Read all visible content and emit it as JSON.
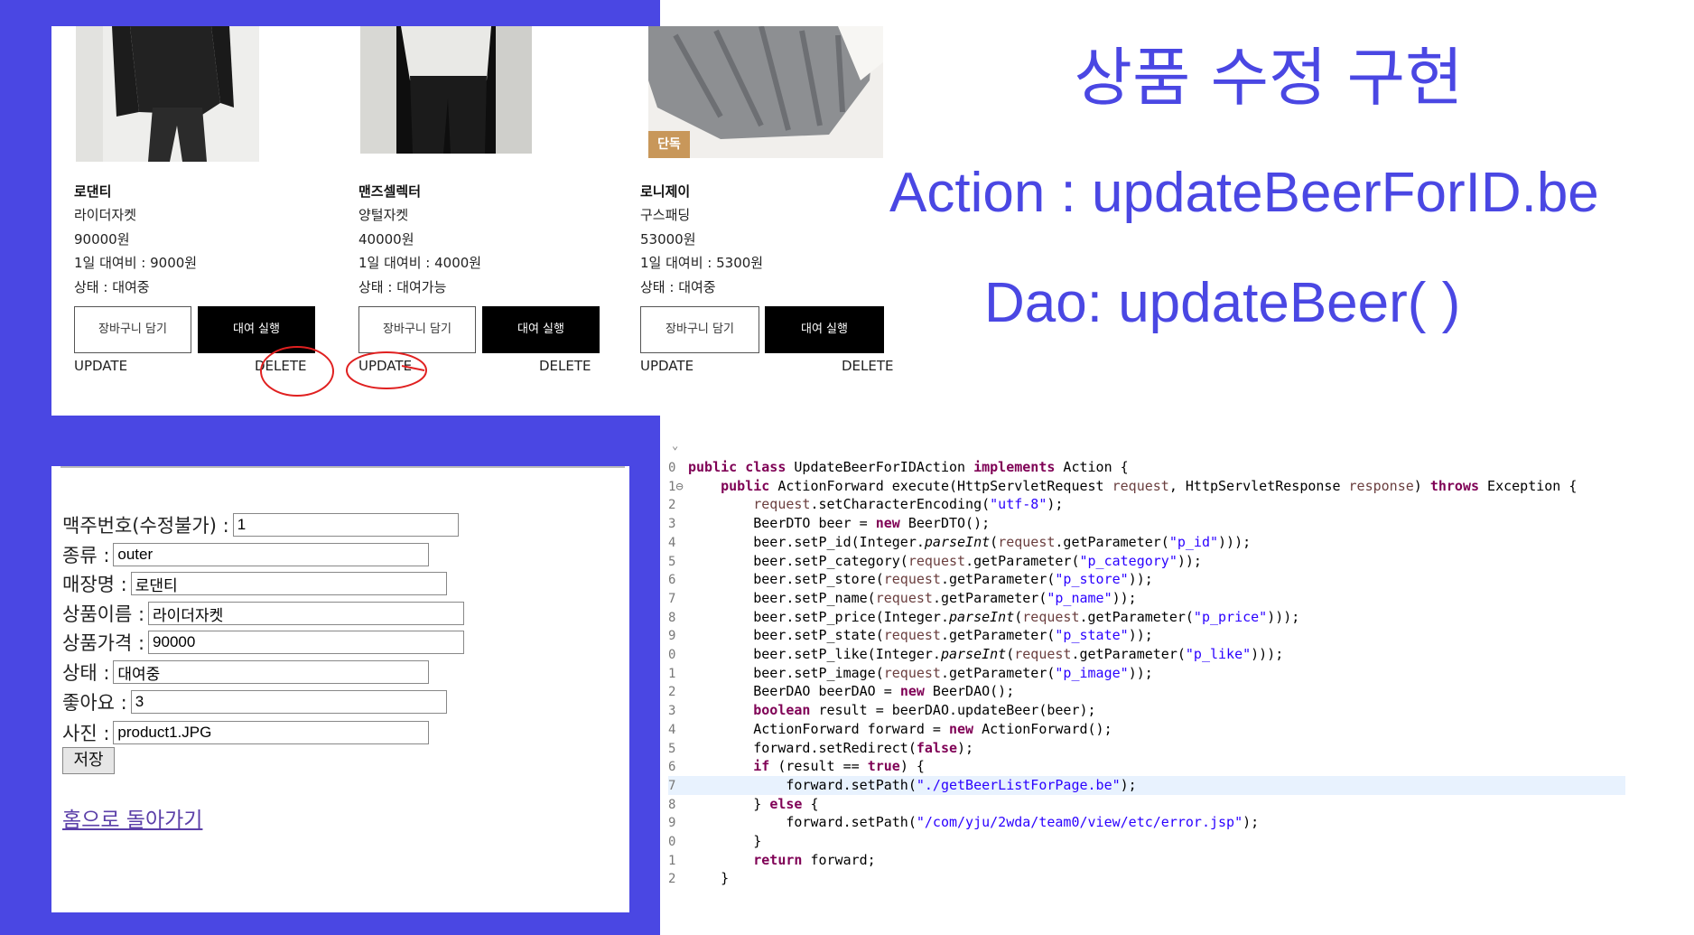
{
  "slide": {
    "title": "상품 수정 구현",
    "action_line": "Action : updateBeerForID.be",
    "dao_line": "Dao: updateBeer( )"
  },
  "products": [
    {
      "brand": "로댄티",
      "name": "라이더자켓",
      "price": "90000원",
      "daily_fee": "1일 대여비 : 9000원",
      "status": "상태 : 대여중",
      "cart_label": "장바구니 담기",
      "rent_label": "대여 실행",
      "update_label": "UPDATE",
      "delete_label": "DELETE"
    },
    {
      "brand": "맨즈셀렉터",
      "name": "양털자켓",
      "price": "40000원",
      "daily_fee": "1일 대여비 : 4000원",
      "status": "상태 : 대여가능",
      "cart_label": "장바구니 담기",
      "rent_label": "대여 실행",
      "update_label": "UPDATE",
      "delete_label": "DELETE"
    },
    {
      "brand": "로니제이",
      "name": "구스패딩",
      "price": "53000원",
      "daily_fee": "1일 대여비 : 5300원",
      "status": "상태 : 대여중",
      "cart_label": "장바구니 담기",
      "rent_label": "대여 실행",
      "update_label": "UPDATE",
      "delete_label": "DELETE",
      "badge": "단독"
    }
  ],
  "form": {
    "fields": [
      {
        "label": "맥주번호(수정불가) :",
        "value": "1"
      },
      {
        "label": "종류 :",
        "value": "outer"
      },
      {
        "label": "매장명 :",
        "value": "로댄티"
      },
      {
        "label": "상품이름 :",
        "value": "라이더자켓"
      },
      {
        "label": "상품가격 :",
        "value": "90000"
      },
      {
        "label": "상태 :",
        "value": "대여중"
      },
      {
        "label": "좋아요 :",
        "value": "3"
      },
      {
        "label": "사진 :",
        "value": "product1.JPG"
      }
    ],
    "save_label": "저장",
    "home_link": "홈으로 돌아가기"
  },
  "code": {
    "gutter": [
      "0",
      "1⊖",
      "2",
      "3",
      "4",
      "5",
      "6",
      "7",
      "8",
      "9",
      "0",
      "1",
      "2",
      "3",
      "4",
      "5",
      "6",
      "7",
      "8",
      "9",
      "0",
      "1",
      "2"
    ],
    "highlighted_line": 17,
    "lines": [
      "public class UpdateBeerForIDAction implements Action {",
      "    public ActionForward execute(HttpServletRequest request, HttpServletResponse response) throws Exception {",
      "        request.setCharacterEncoding(\"utf-8\");",
      "        BeerDTO beer = new BeerDTO();",
      "        beer.setP_id(Integer.parseInt(request.getParameter(\"p_id\")));",
      "        beer.setP_category(request.getParameter(\"p_category\"));",
      "        beer.setP_store(request.getParameter(\"p_store\"));",
      "        beer.setP_name(request.getParameter(\"p_name\"));",
      "        beer.setP_price(Integer.parseInt(request.getParameter(\"p_price\")));",
      "        beer.setP_state(request.getParameter(\"p_state\"));",
      "        beer.setP_like(Integer.parseInt(request.getParameter(\"p_like\")));",
      "        beer.setP_image(request.getParameter(\"p_image\"));",
      "        BeerDAO beerDAO = new BeerDAO();",
      "        boolean result = beerDAO.updateBeer(beer);",
      "        ActionForward forward = new ActionForward();",
      "        forward.setRedirect(false);",
      "        if (result == true) {",
      "            forward.setPath(\"./getBeerListForPage.be\");",
      "        } else {",
      "            forward.setPath(\"/com/yju/2wda/team0/view/etc/error.jsp\");",
      "        }",
      "        return forward;",
      "    }"
    ]
  },
  "colors": {
    "accent": "#4a47e3",
    "keyword": "#7f0055",
    "string": "#2a00ff",
    "annotation": "#e02020"
  }
}
